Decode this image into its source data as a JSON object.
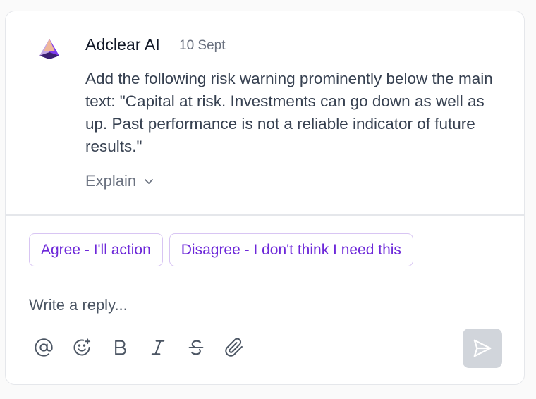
{
  "comment": {
    "author": "Adclear AI",
    "date": "10 Sept",
    "message": "Add the following risk warning prominently below the main text: \"Capital at risk. Investments can go down as well as up. Past performance is not a reliable indicator of future results.\"",
    "explain_label": "Explain",
    "avatar_icon": "adclear-logo-icon"
  },
  "actions": {
    "agree_label": "Agree - I'll action",
    "disagree_label": "Disagree - I don't think I need this"
  },
  "reply": {
    "placeholder": "Write a reply...",
    "value": ""
  },
  "toolbar": {
    "icons": [
      "at-sign-icon",
      "emoji-add-icon",
      "bold-icon",
      "italic-icon",
      "strikethrough-icon",
      "paperclip-icon"
    ],
    "send_icon": "send-icon"
  },
  "colors": {
    "accent": "#6d28d9",
    "accent_border": "#d8c5f3",
    "send_disabled_bg": "#d1d5db",
    "icon": "#4b5563"
  }
}
